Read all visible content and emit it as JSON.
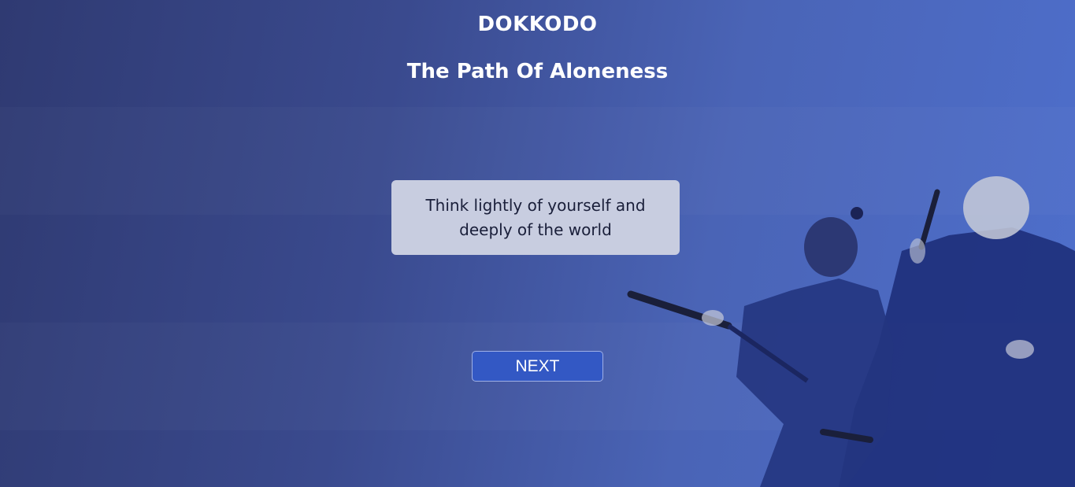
{
  "header": {
    "title": "DOKKODO",
    "subtitle": "The Path Of Aloneness"
  },
  "quote": {
    "text": "Think lightly of yourself and deeply of the world"
  },
  "navigation": {
    "next_label": "NEXT"
  },
  "colors": {
    "background_dark": "#2f3a72",
    "background_light": "#4e6fcc",
    "quote_box": "#c8cde0",
    "button": "#3358c4",
    "text_light": "#ffffff"
  }
}
